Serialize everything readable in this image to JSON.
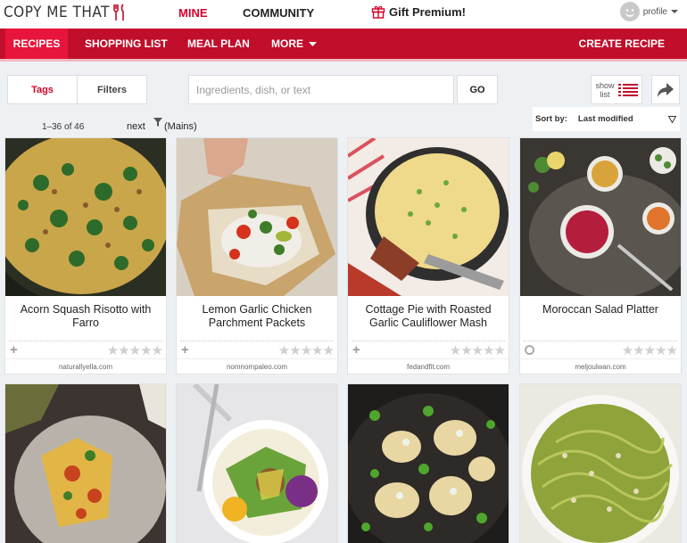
{
  "brand": {
    "name": "COPY ME THAT",
    "accent": "#c10e2b"
  },
  "top_nav": {
    "mine": "MINE",
    "community": "COMMUNITY",
    "premium": "Gift Premium!",
    "profile": "profile"
  },
  "main_nav": {
    "recipes": "RECIPES",
    "shopping_list": "SHOPPING LIST",
    "meal_plan": "MEAL PLAN",
    "more": "MORE",
    "create_recipe": "CREATE RECIPE"
  },
  "toolbar": {
    "tags": "Tags",
    "filters": "Filters",
    "search_placeholder": "Ingredients, dish, or text",
    "go": "GO",
    "show_list": "show list"
  },
  "pagination": {
    "range": "1–36 of 46",
    "next": "next",
    "filter_label": "(Mains)"
  },
  "sort": {
    "label": "Sort by:",
    "value": "Last modified"
  },
  "recipes": [
    {
      "title": "Acorn Squash Risotto with Farro",
      "source": "naturallyella.com",
      "action": "+",
      "rating": 0
    },
    {
      "title": "Lemon Garlic Chicken Parchment Packets",
      "source": "nomnompaleo.com",
      "action": "+",
      "rating": 0
    },
    {
      "title": "Cottage Pie with Roasted Garlic Cauliflower Mash",
      "source": "fedandfit.com",
      "action": "+",
      "rating": 0
    },
    {
      "title": "Moroccan Salad Platter",
      "source": "meljoulwan.com",
      "action": "circle",
      "rating": 0
    },
    {
      "title": "",
      "source": "",
      "action": "",
      "rating": 0
    },
    {
      "title": "",
      "source": "",
      "action": "",
      "rating": 0
    },
    {
      "title": "",
      "source": "",
      "action": "",
      "rating": 0
    },
    {
      "title": "",
      "source": "",
      "action": "",
      "rating": 0
    }
  ]
}
